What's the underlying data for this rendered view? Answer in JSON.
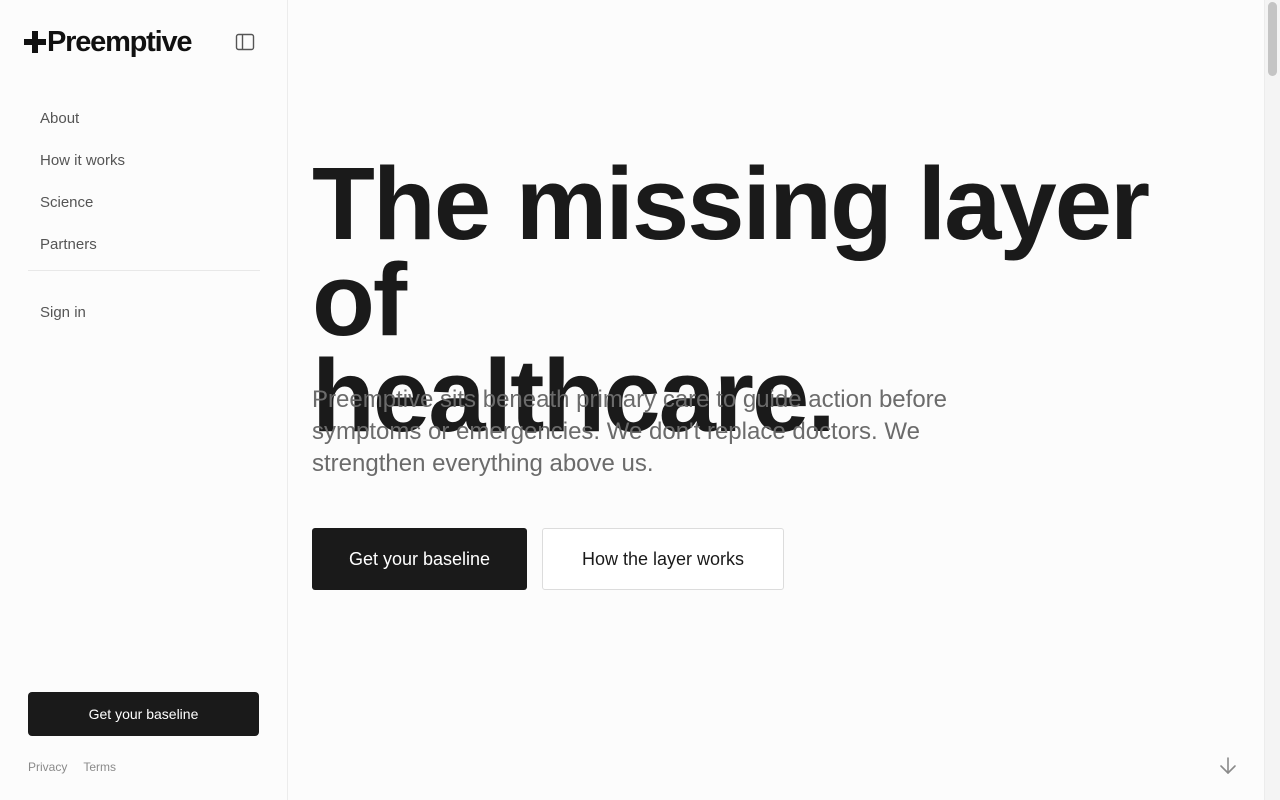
{
  "brand": {
    "name": "Preemptive"
  },
  "sidebar": {
    "nav": [
      {
        "label": "About"
      },
      {
        "label": "How it works"
      },
      {
        "label": "Science"
      },
      {
        "label": "Partners"
      }
    ],
    "sign_in": "Sign in",
    "cta": "Get your baseline",
    "footer": {
      "privacy": "Privacy",
      "terms": "Terms"
    }
  },
  "hero": {
    "headline_line1": "The missing layer of",
    "headline_line2": "healthcare.",
    "subtext": "Preemptive sits beneath primary care to guide action before symptoms or emergencies. We don't replace doctors. We strengthen everything above us.",
    "primary_cta": "Get your baseline",
    "secondary_cta": "How the layer works"
  },
  "icons": {
    "sidebar_toggle": "sidebar-panel-icon",
    "scroll": "arrow-down-icon"
  },
  "colors": {
    "background": "#fcfcfc",
    "primary": "#1a1a1a",
    "muted_text": "#6b6b6b"
  }
}
